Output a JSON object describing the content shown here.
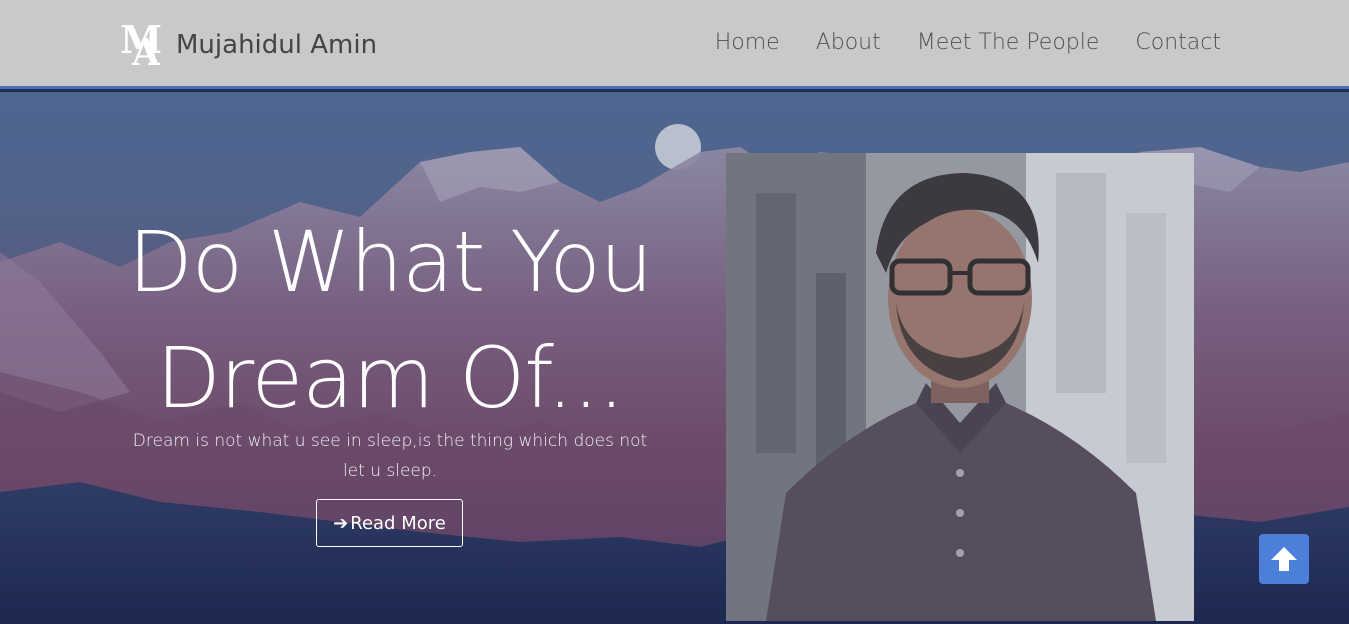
{
  "brand": {
    "logo_text": "MA",
    "name": "Mujahidul Amin"
  },
  "nav": {
    "items": [
      "Home",
      "About",
      "Meet The People",
      "Contact"
    ]
  },
  "hero": {
    "headline_line1": "Do What You",
    "headline_line2": "Dream Of...",
    "subtext": "Dream is not what u see in sleep,is the thing which does not let u sleep.",
    "button_label": "Read More",
    "button_icon": "arrow-right-icon"
  },
  "scroll_top": {
    "icon": "arrow-up-icon"
  },
  "colors": {
    "navbar_bg": "#c8c9c8",
    "accent": "#4c7fd9",
    "hero_text": "#ffffff"
  }
}
